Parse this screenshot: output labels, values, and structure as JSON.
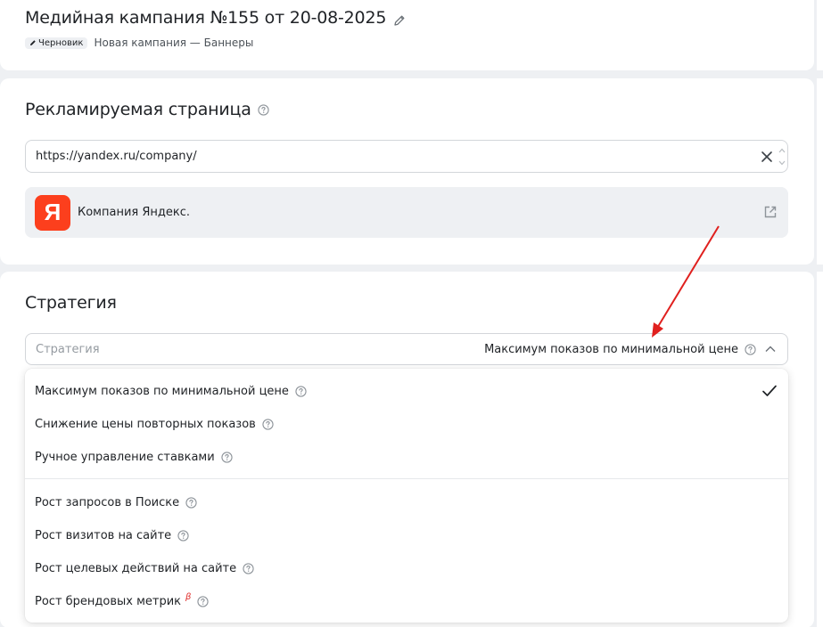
{
  "campaign": {
    "title": "Медийная кампания №155 от 20-08-2025",
    "status_badge": "Черновик",
    "subtitle": "Новая кампания — Баннеры"
  },
  "advertised_page": {
    "title": "Рекламируемая страница",
    "url_value": "https://yandex.ru/company/",
    "company_name": "Компания Яндекс.",
    "logo_letter": "Я"
  },
  "strategy": {
    "title": "Стратегия",
    "select_placeholder": "Стратегия",
    "select_value": "Максимум показов по минимальной цене",
    "options_group1": [
      {
        "label": "Максимум показов по минимальной цене",
        "selected": true
      },
      {
        "label": "Снижение цены повторных показов",
        "selected": false
      },
      {
        "label": "Ручное управление ставками",
        "selected": false
      }
    ],
    "options_group2": [
      {
        "label": "Рост запросов в Поиске"
      },
      {
        "label": "Рост визитов на сайте"
      },
      {
        "label": "Рост целевых действий на сайте"
      },
      {
        "label": "Рост брендовых метрик",
        "badge": "β"
      }
    ]
  },
  "colors": {
    "yandex_red": "#fc3f1d",
    "annotation_arrow": "#e0201e",
    "beta": "#e0302d"
  }
}
